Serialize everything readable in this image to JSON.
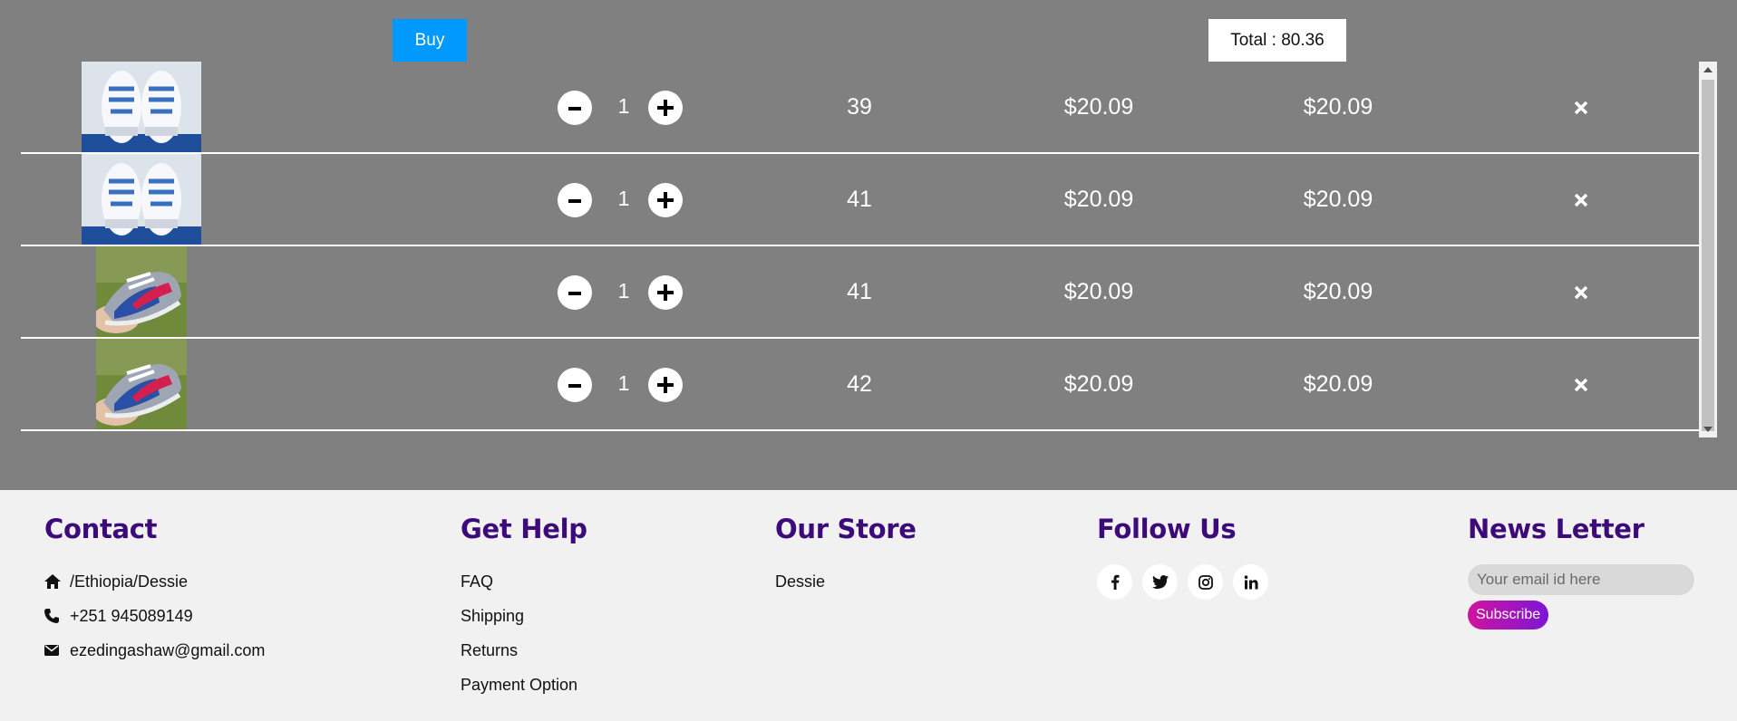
{
  "cart": {
    "buy_label": "Buy",
    "total_label": "Total : 80.36",
    "items": [
      {
        "product": "white-blue-sneaker",
        "quantity": "1",
        "size": "39",
        "price": "$20.09",
        "subtotal": "$20.09"
      },
      {
        "product": "white-blue-sneaker",
        "quantity": "1",
        "size": "41",
        "price": "$20.09",
        "subtotal": "$20.09"
      },
      {
        "product": "blue-grey-red-low-top-sneaker",
        "quantity": "1",
        "size": "41",
        "price": "$20.09",
        "subtotal": "$20.09"
      },
      {
        "product": "blue-grey-red-low-top-sneaker",
        "quantity": "1",
        "size": "42",
        "price": "$20.09",
        "subtotal": "$20.09"
      }
    ]
  },
  "footer": {
    "contact": {
      "title": "Contact",
      "address": "/Ethiopia/Dessie",
      "phone": "+251 945089149",
      "email": "ezedingashaw@gmail.com"
    },
    "help": {
      "title": "Get Help",
      "links": [
        "FAQ",
        "Shipping",
        "Returns",
        "Payment Option"
      ]
    },
    "store": {
      "title": "Our Store",
      "location": "Dessie"
    },
    "follow": {
      "title": "Follow Us",
      "networks": [
        "facebook-icon",
        "twitter-icon",
        "instagram-icon",
        "linkedin-icon"
      ]
    },
    "newsletter": {
      "title": "News Letter",
      "placeholder": "Your email id here",
      "subscribe_label": "Subscribe"
    }
  },
  "colors": {
    "cart_background": "#808080",
    "buy_button": "#0099ff",
    "heading": "#3d0a7a",
    "subscribe_gradient": [
      "#d0149e",
      "#7d16d4"
    ]
  }
}
